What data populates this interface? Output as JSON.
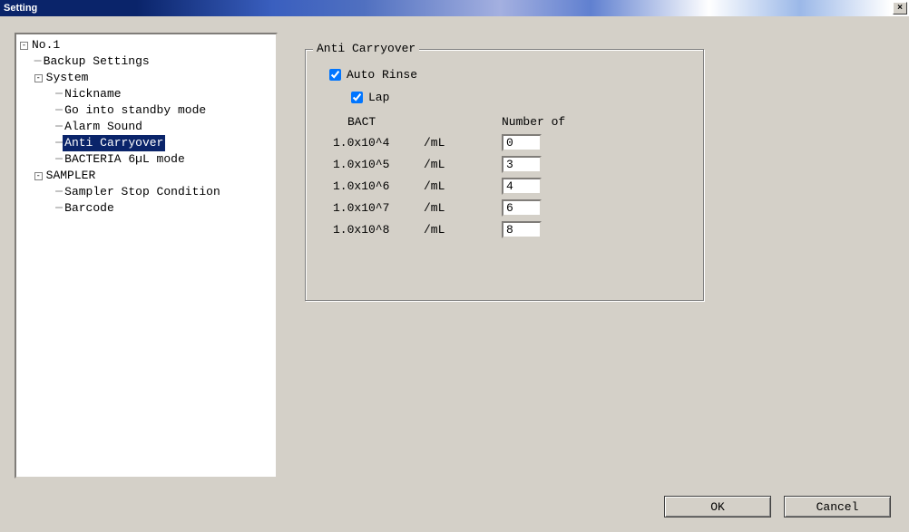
{
  "window": {
    "title": "Setting",
    "close": "×"
  },
  "tree": {
    "root": {
      "label": "No.1",
      "expander": "-"
    },
    "backup": "Backup Settings",
    "system": {
      "label": "System",
      "expander": "-"
    },
    "nickname": "Nickname",
    "standby": "Go into standby mode",
    "alarm": "Alarm Sound",
    "anticarry": "Anti Carryover",
    "bacteria": "BACTERIA 6µL mode",
    "sampler": {
      "label": "SAMPLER",
      "expander": "-"
    },
    "stopcond": "Sampler Stop Condition",
    "barcode": "Barcode"
  },
  "group": {
    "legend": "Anti Carryover",
    "auto_rinse": "Auto Rinse",
    "lap": "Lap",
    "col_bact": "BACT",
    "col_num": "Number of",
    "rows": [
      {
        "bact": "1.0x10^4",
        "unit": "/mL",
        "value": "0"
      },
      {
        "bact": "1.0x10^5",
        "unit": "/mL",
        "value": "3"
      },
      {
        "bact": "1.0x10^6",
        "unit": "/mL",
        "value": "4"
      },
      {
        "bact": "1.0x10^7",
        "unit": "/mL",
        "value": "6"
      },
      {
        "bact": "1.0x10^8",
        "unit": "/mL",
        "value": "8"
      }
    ]
  },
  "buttons": {
    "ok": "OK",
    "cancel": "Cancel"
  }
}
